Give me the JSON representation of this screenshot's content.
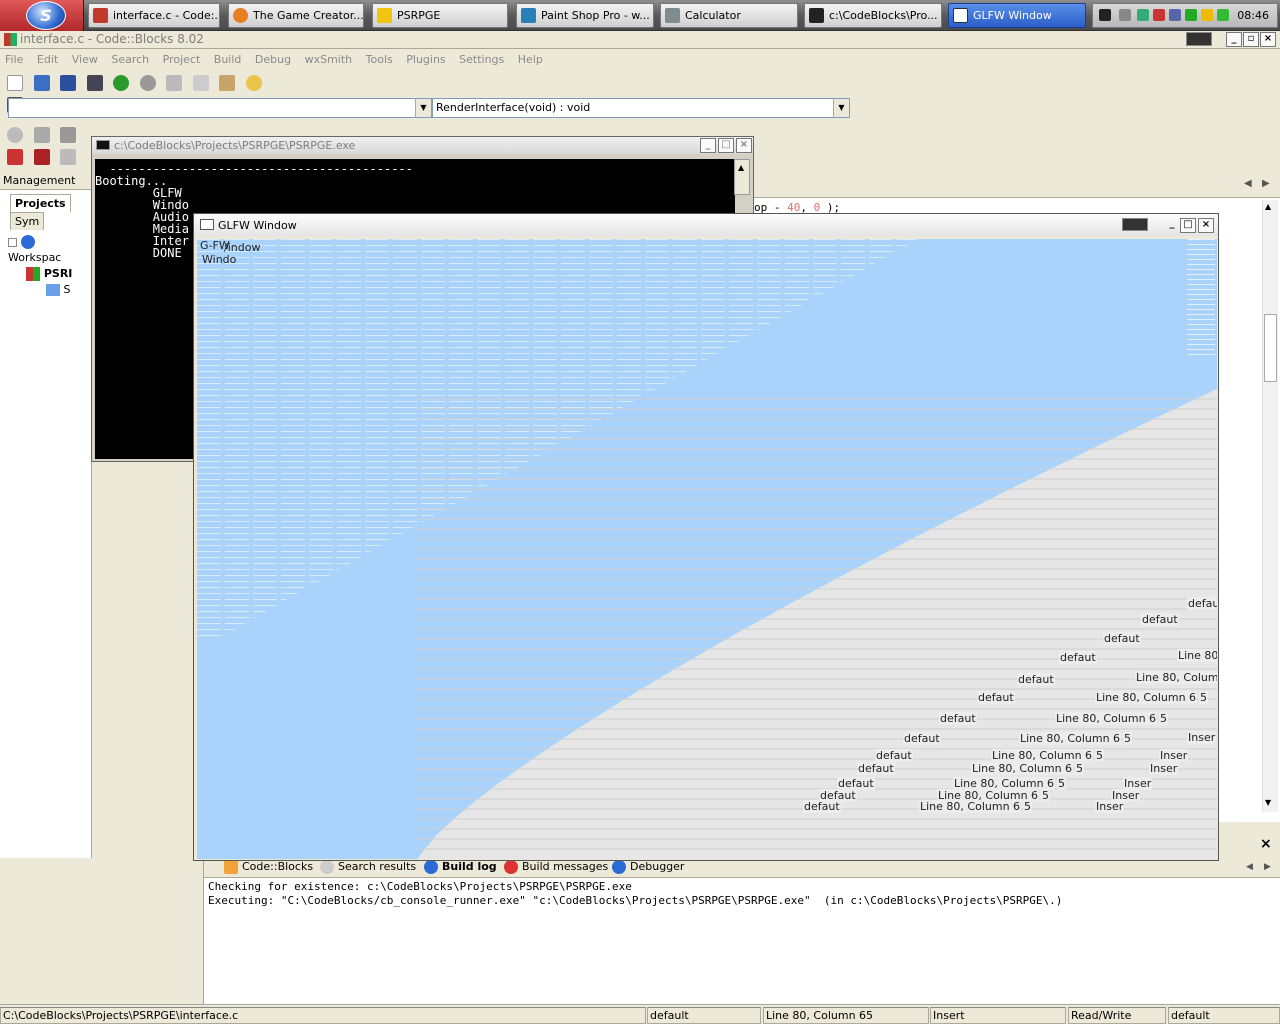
{
  "taskbar": {
    "start_label": "S",
    "items": [
      {
        "label": "interface.c - Code:...",
        "icon": "codeblocks-icon",
        "color": "#c0392b"
      },
      {
        "label": "The Game Creator...",
        "icon": "firefox-icon",
        "color": "#e67e22"
      },
      {
        "label": "PSRPGE",
        "icon": "folder-icon",
        "color": "#f1c40f"
      },
      {
        "label": "Paint Shop Pro - w...",
        "icon": "paintshop-icon",
        "color": "#2980b9"
      },
      {
        "label": "Calculator",
        "icon": "calculator-icon",
        "color": "#7f8c8d"
      },
      {
        "label": "c:\\CodeBlocks\\Pro...",
        "icon": "console-icon",
        "color": "#222222"
      },
      {
        "label": "GLFW Window",
        "icon": "window-icon",
        "color": "#ffffff"
      }
    ],
    "clock": "08:46"
  },
  "main_window": {
    "title": "interface.c - Code::Blocks 8.02"
  },
  "menu": [
    "File",
    "Edit",
    "View",
    "Search",
    "Project",
    "Build",
    "Debug",
    "wxSmith",
    "Tools",
    "Plugins",
    "Settings",
    "Help"
  ],
  "toolbar2": {
    "scope_value": "",
    "function_value": "RenderInterface(void) : void"
  },
  "management": {
    "title": "Management",
    "tabs": [
      "Projects",
      "Sym"
    ],
    "tree": [
      "Workspac",
      "PSRI",
      "S"
    ]
  },
  "editor": {
    "code_line_a": "op - ",
    "code_num1": "40",
    "code_comma": ", ",
    "code_num2": "0",
    "code_end": " );"
  },
  "console": {
    "title": "c:\\CodeBlocks\\Projects\\PSRPGE\\PSRPGE.exe",
    "lines": [
      "",
      "",
      "  ------------------------------------------",
      "",
      "Booting...",
      "",
      "        GLFW",
      "        Windo",
      "        Audio",
      "        Media",
      "        Inter",
      "        DONE"
    ]
  },
  "glfw": {
    "title": "GLFW Window",
    "ghost_title_1": "G-FW",
    "ghost_title_2": "/indow",
    "ghost_title_3": "Windo",
    "canvas_color": "#a9d3fb",
    "ghost_default": "defau",
    "ghost_default_t": "t",
    "ghost_line": "Line 80, Column 6",
    "ghost_col": "5",
    "ghost_insert": "Inser"
  },
  "logs": {
    "tabs": [
      "Code::Blocks",
      "Search results",
      "Build log",
      "Build messages",
      "Debugger"
    ],
    "selected": "Build log",
    "lines": [
      "Checking for existence: c:\\CodeBlocks\\Projects\\PSRPGE\\PSRPGE.exe",
      "Executing: \"C:\\CodeBlocks/cb_console_runner.exe\" \"c:\\CodeBlocks\\Projects\\PSRPGE\\PSRPGE.exe\"  (in c:\\CodeBlocks\\Projects\\PSRPGE\\.)"
    ]
  },
  "status": {
    "path": "C:\\CodeBlocks\\Projects\\PSRPGE\\interface.c",
    "encoding": "default",
    "position": "Line 80, Column 65",
    "mode": "Insert",
    "access": "Read/Write",
    "highlight": "default"
  }
}
